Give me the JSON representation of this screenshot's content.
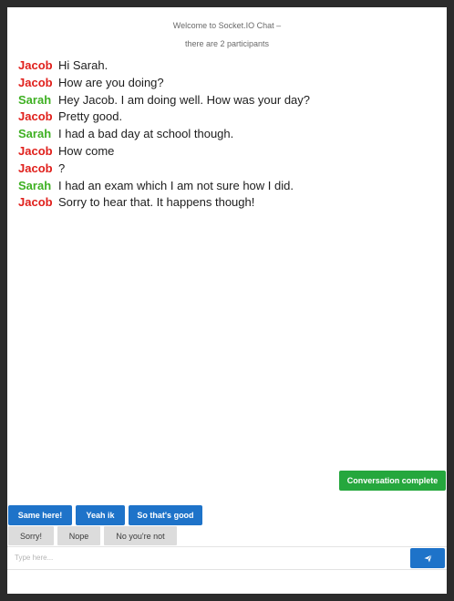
{
  "header": {
    "line1": "Welcome to Socket.IO Chat –",
    "line2": "there are 2 participants"
  },
  "messages": [
    {
      "sender": "Jacob",
      "text": "Hi Sarah."
    },
    {
      "sender": "Jacob",
      "text": "How are you doing?"
    },
    {
      "sender": "Sarah",
      "text": "Hey Jacob. I am doing well. How was your day?"
    },
    {
      "sender": "Jacob",
      "text": "Pretty good."
    },
    {
      "sender": "Sarah",
      "text": "I had a bad day at school though."
    },
    {
      "sender": "Jacob",
      "text": "How come"
    },
    {
      "sender": "Jacob",
      "text": "?"
    },
    {
      "sender": "Sarah",
      "text": "I had an exam which I am not sure how I did."
    },
    {
      "sender": "Jacob",
      "text": "Sorry to hear that. It happens though!"
    }
  ],
  "colors": {
    "jacob": "#e0201c",
    "sarah": "#3fb023",
    "primary_button": "#1e73c9",
    "complete_button": "#25a73d"
  },
  "actions": {
    "complete_label": "Conversation complete"
  },
  "suggestions": [
    "Same here!",
    "Yeah ik",
    "So that's good"
  ],
  "quick_replies": [
    "Sorry!",
    "Nope",
    "No you're not"
  ],
  "composer": {
    "placeholder": "Type here...",
    "send_icon": "send-icon"
  }
}
